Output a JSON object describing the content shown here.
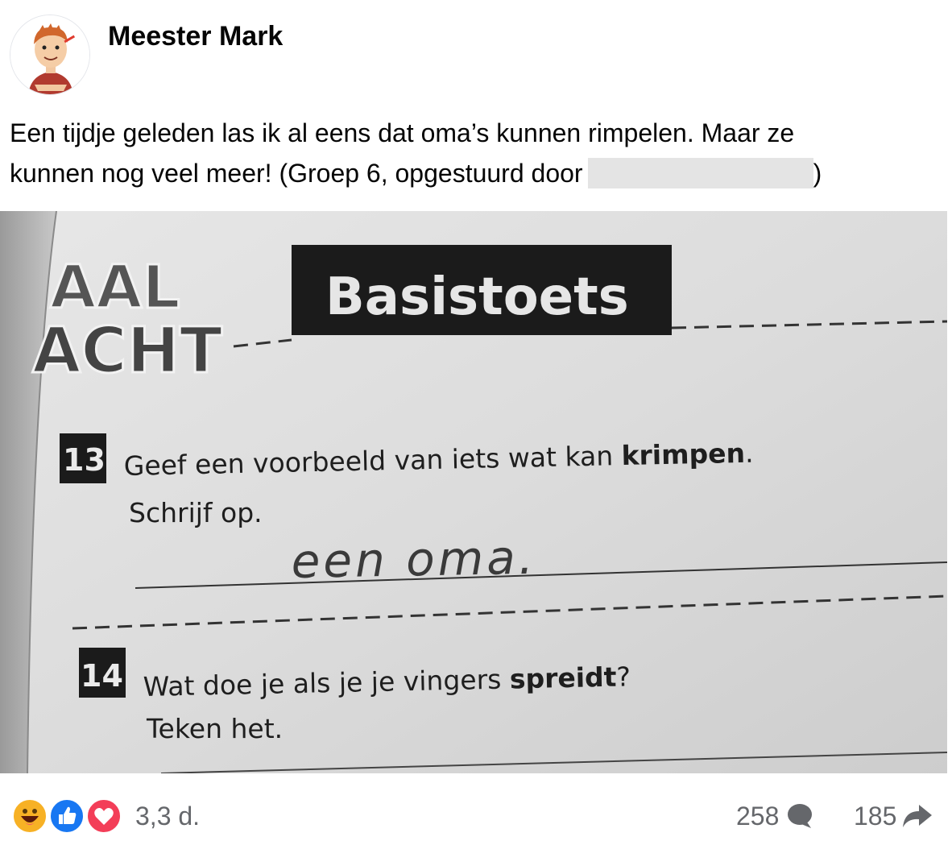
{
  "post": {
    "author": "Meester Mark",
    "caption_line1": "Een tijdje geleden las ik al eens dat oma’s kunnen rimpelen. Maar ze",
    "caption_line2": "kunnen nog veel meer! (Groep 6, opgestuurd door",
    "caption_end": ")"
  },
  "photo": {
    "logo_line1": "AAL",
    "logo_line2": "ACHT",
    "banner": "Basistoets",
    "q13_number": "13",
    "q13_text": "Geef een voorbeeld van iets wat kan ",
    "q13_bold": "krimpen",
    "q13_end": ".",
    "q13_instruction": "Schrijf op.",
    "q13_answer": "een oma.",
    "q14_number": "14",
    "q14_text": "Wat doe je als je je vingers ",
    "q14_bold": "spreidt",
    "q14_end": "?",
    "q14_instruction": "Teken het."
  },
  "footer": {
    "reaction_icons": [
      "haha-icon",
      "like-icon",
      "love-icon"
    ],
    "timestamp": "3,3 d.",
    "comments_count": "258",
    "shares_count": "185"
  },
  "colors": {
    "like": "#1877f2",
    "love": "#f33e58",
    "haha": "#f7b125",
    "secondary_text": "#65676b"
  }
}
